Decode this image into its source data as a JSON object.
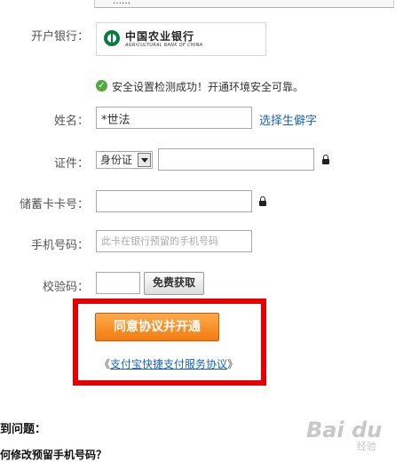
{
  "top_notice": "……",
  "bank": {
    "label": "开户银行：",
    "name": "中国农业银行",
    "english_name": "AGRICULTURAL BANK OF CHINA"
  },
  "security": {
    "message": "安全设置检测成功！开通环境安全可靠。"
  },
  "name_field": {
    "label": "姓名：",
    "value": "*世法",
    "rare_char_link": "选择生僻字"
  },
  "id_field": {
    "label": "证件：",
    "type_selected": "身份证",
    "value": ""
  },
  "card_field": {
    "label": "储蓄卡卡号：",
    "value": ""
  },
  "phone_field": {
    "label": "手机号码：",
    "placeholder": "此卡在银行预留的手机号码"
  },
  "verify_field": {
    "label": "校验码：",
    "value": "",
    "get_code_button": "免费获取"
  },
  "submit_button": "同意协议并开通",
  "agreement": {
    "open": "《",
    "link": "支付宝快捷支付服务协议",
    "close": "》"
  },
  "help": {
    "title": "遇到问题：",
    "question": "如何修改预留手机号码？"
  },
  "watermark": {
    "main": "Bai du",
    "sub": "经验"
  },
  "colors": {
    "accent_orange": "#f07c10",
    "link_blue": "#1a64b8",
    "highlight_red": "#e60000",
    "bank_green": "#0a7a3f",
    "success_green": "#53a93f"
  }
}
